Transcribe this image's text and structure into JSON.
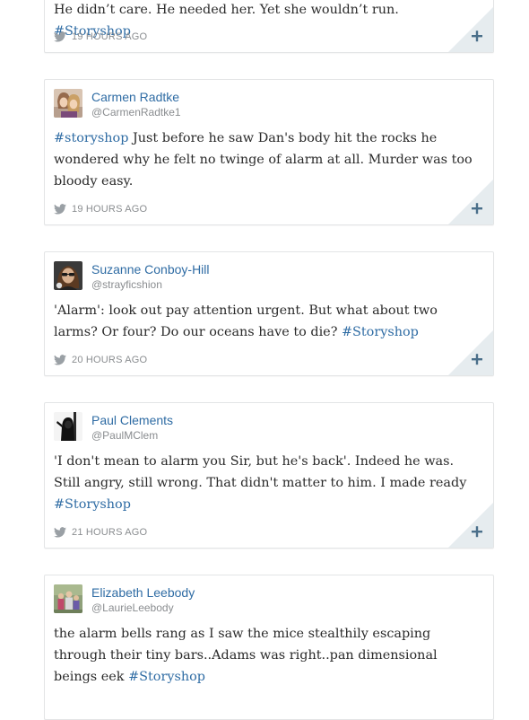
{
  "tweets": [
    {
      "name": "",
      "handle": "",
      "text_before": "He didn’t care. He needed her. Yet she wouldn’t run. ",
      "hashtag": "#Storyshop",
      "text_after": "",
      "time": "19 HOURS AGO",
      "avatar": "none"
    },
    {
      "name": "Carmen Radtke",
      "handle": "@CarmenRadtke1",
      "text_before": "",
      "hashtag": "#storyshop",
      "text_after": " Just before he saw Dan's body hit the rocks he wondered why he felt no twinge of alarm at all. Murder was too bloody easy.",
      "time": "19 HOURS AGO",
      "avatar": "two-women-photo"
    },
    {
      "name": "Suzanne Conboy-Hill",
      "handle": "@strayficshion",
      "text_before": "'Alarm': look out pay attention urgent. But what about two larms? Or four? Do our oceans have to die? ",
      "hashtag": "#Storyshop",
      "text_after": "",
      "time": "20 HOURS AGO",
      "avatar": "woman-sunglasses-photo"
    },
    {
      "name": "Paul Clements",
      "handle": "@PaulMClem",
      "text_before": "'I don't mean to alarm you Sir, but he's back'. Indeed he was. Still angry, still wrong. That didn't matter to him. I made ready ",
      "hashtag": "#Storyshop",
      "text_after": "",
      "time": "21 HOURS AGO",
      "avatar": "hooded-figure-photo"
    },
    {
      "name": "Elizabeth Leebody",
      "handle": "@LaurieLeebody",
      "text_before": "the alarm bells rang as I saw the mice stealthily escaping through their tiny bars..Adams was right..pan dimensional beings eek ",
      "hashtag": "#Storyshop",
      "text_after": "",
      "time": "",
      "avatar": "family-photo"
    }
  ],
  "icons": {
    "bird": "twitter-bird-icon",
    "expand": "plus-icon"
  },
  "colors": {
    "link": "#2f6ca4",
    "meta": "#8a8d90",
    "corner": "#e6ecef",
    "plus": "#4a6f8a"
  }
}
